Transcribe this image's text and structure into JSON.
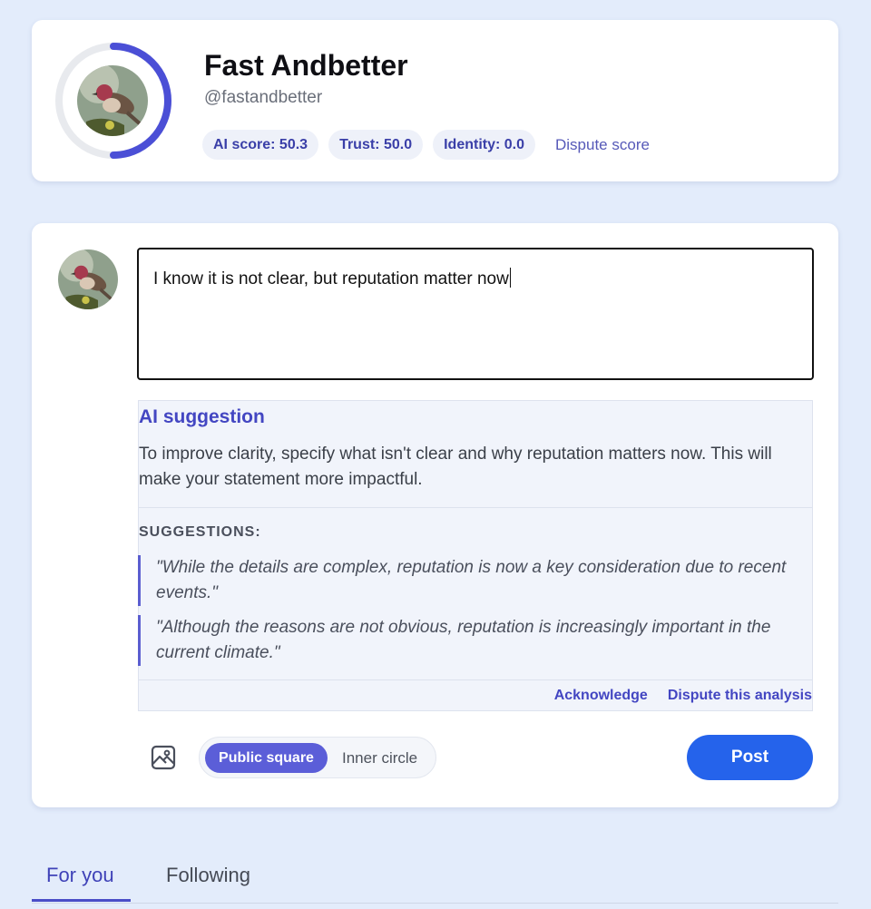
{
  "profile": {
    "name": "Fast Andbetter",
    "handle": "@fastandbetter",
    "score_ring_fraction": 0.5,
    "ring_color": "#4b4fd6",
    "chips": {
      "ai_score": "AI score: 50.3",
      "trust": "Trust: 50.0",
      "identity": "Identity: 0.0"
    },
    "dispute_label": "Dispute score"
  },
  "composer": {
    "text": "I know it is not clear, but reputation matter now",
    "ai_suggestion": {
      "title": "AI suggestion",
      "body": "To improve clarity, specify what isn't clear and why reputation matters now. This will make your statement more impactful.",
      "suggestions_heading": "SUGGESTIONS:",
      "suggestions": [
        "\"While the details are complex, reputation is now a key consideration due to recent events.\"",
        "\"Although the reasons are not obvious, reputation is increasingly important in the current climate.\""
      ],
      "acknowledge_label": "Acknowledge",
      "dispute_label": "Dispute this analysis"
    },
    "image_icon": "image-icon",
    "audience": {
      "selected": "Public square",
      "other": "Inner circle"
    },
    "post_label": "Post",
    "post_color": "#2563eb"
  },
  "feed_tabs": {
    "active": "For you",
    "inactive": "Following"
  }
}
